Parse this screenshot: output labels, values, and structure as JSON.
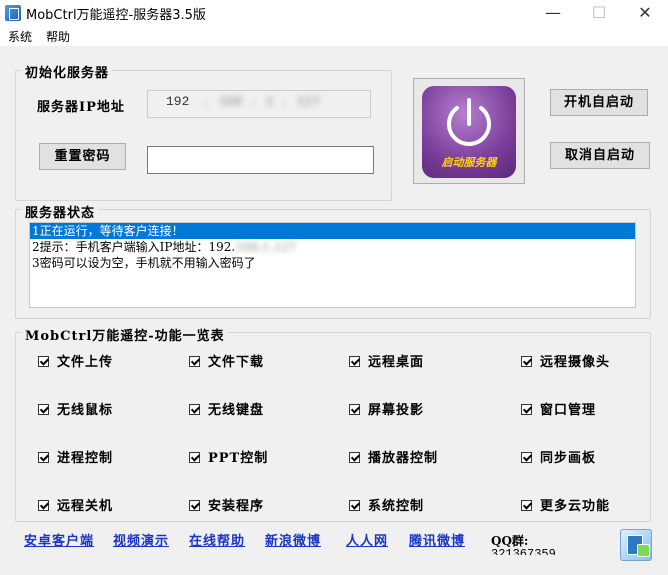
{
  "window": {
    "title": "MobCtrl万能遥控-服务器3.5版",
    "minimize_icon": "—",
    "maximize_icon": "☐",
    "close_icon": "✕"
  },
  "menu": [
    "系统",
    "帮助"
  ],
  "init_group": {
    "title": "初始化服务器",
    "ip_label": "服务器IP地址",
    "ip_value": "192 . 168 . 1 . 127",
    "ip_first_octet": "192",
    "ip_rest_octets": ". 168 . 1 . 127",
    "reset_password_button": "重置密码",
    "password_value": ""
  },
  "power_button": {
    "label": "启动服务器",
    "color": "#7a3d9a",
    "label_color": "#ffd400"
  },
  "side_buttons": {
    "autostart": "开机自启动",
    "cancel_autostart": "取消自启动"
  },
  "status_group": {
    "title": "服务器状态",
    "lines": [
      "1正在运行，等待客户连接！",
      "2提示：手机客户端输入IP地址：192.168.1.127",
      "3密码可以设为空，手机就不用输入密码了"
    ],
    "line2_prefix": "2提示：手机客户端输入IP地址：192.",
    "line2_blurred": "168.1.127",
    "selection_color": "#0078d7"
  },
  "features_group": {
    "title": "MobCtrl万能遥控-功能一览表",
    "items": [
      "文件上传",
      "文件下载",
      "远程桌面",
      "远程摄像头",
      "无线鼠标",
      "无线键盘",
      "屏幕投影",
      "窗口管理",
      "进程控制",
      "PPT控制",
      "播放器控制",
      "同步画板",
      "远程关机",
      "安装程序",
      "系统控制",
      "更多云功能"
    ]
  },
  "footer": {
    "links": [
      "安卓客户端",
      "视频演示",
      "在线帮助",
      "新浪微博",
      "人人网",
      "腾讯微博"
    ],
    "qq_label": "QQ群:",
    "qq_number": "321367359",
    "link_color": "#1a35c8"
  }
}
